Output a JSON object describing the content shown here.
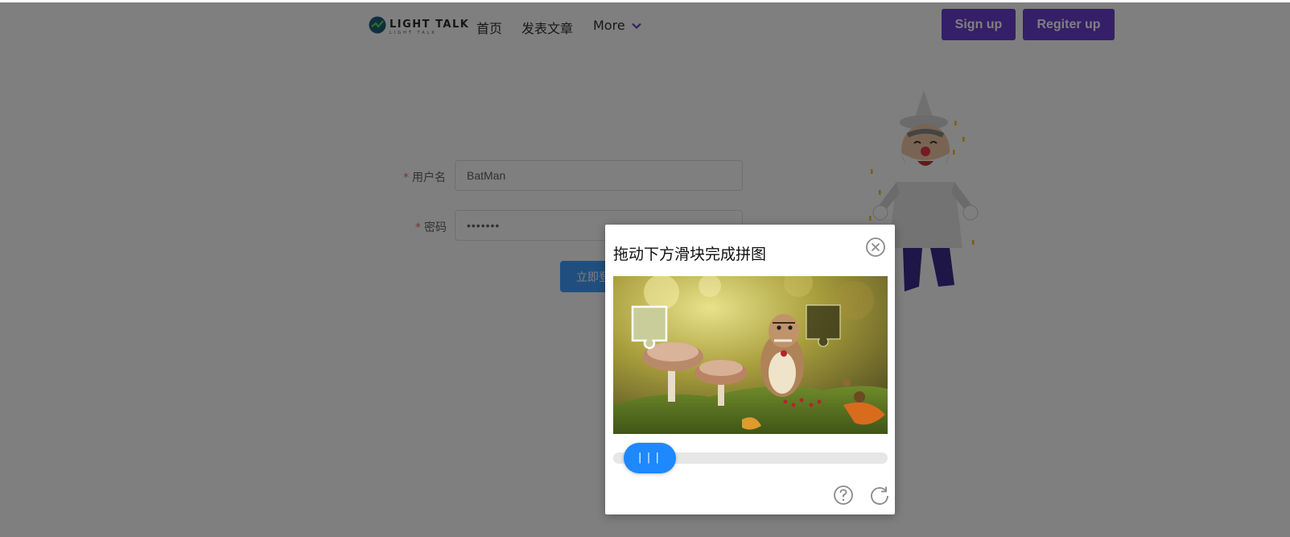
{
  "header": {
    "logo_text": "LIGHT TALK",
    "logo_subtext": "LIGHT TALK",
    "nav": [
      {
        "label": "首页"
      },
      {
        "label": "发表文章"
      },
      {
        "label": "More"
      }
    ],
    "signup_label": "Sign up",
    "register_label": "Regiter up"
  },
  "form": {
    "username_label": "用户名",
    "username_value": "BatMan",
    "password_label": "密码",
    "password_value": "•••••••",
    "required_mark": "*",
    "submit_label": "立即登录"
  },
  "captcha": {
    "title": "拖动下方滑块完成拼图",
    "slider_grip": "|||",
    "slider_progress": 0
  },
  "colors": {
    "brand_purple": "#6a3fd0",
    "primary_blue": "#409eff",
    "slider_blue": "#1e88ff",
    "required_red": "#f56c6c"
  },
  "icons": {
    "more": "chevron-down-icon",
    "close": "close-circle-icon",
    "help": "question-circle-icon",
    "refresh": "refresh-icon"
  }
}
